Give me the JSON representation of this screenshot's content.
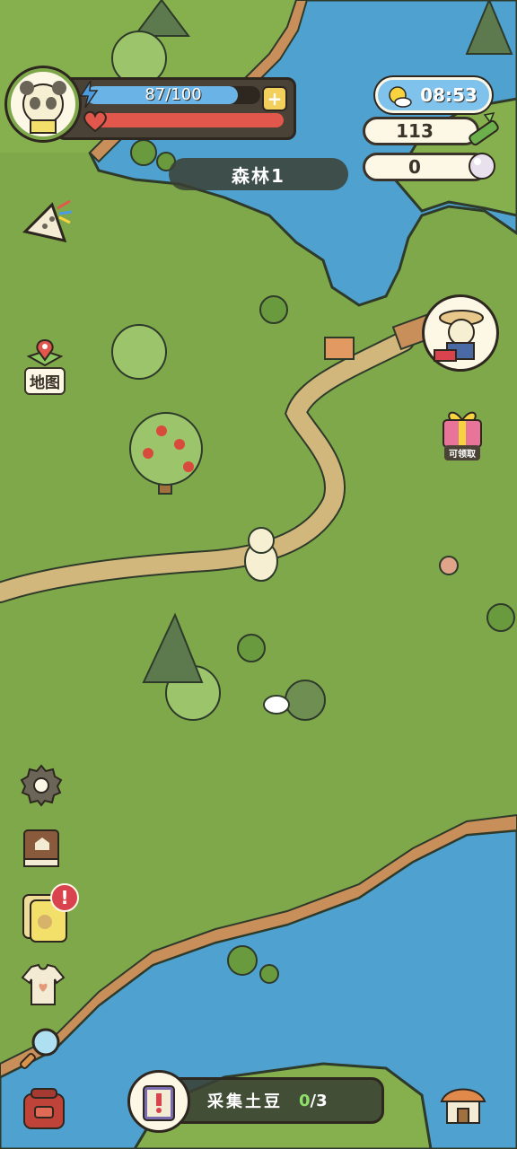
{
  "player": {
    "energy_text": "87/100",
    "energy_fraction": 0.87,
    "health_fraction": 1.0,
    "add_energy_glyph": "+"
  },
  "status": {
    "time": "08:53",
    "bamboo_count": "113",
    "pearl_count": "0"
  },
  "location": {
    "name": "森林1"
  },
  "left_menu": {
    "map_label": "地图",
    "alert_glyph": "!"
  },
  "right_menu": {
    "gift_label": "可领取"
  },
  "quest": {
    "title": "采集土豆",
    "progress_current": "0",
    "progress_total": "/3"
  },
  "icons": {
    "energy": "lightning-icon",
    "health": "heart-icon",
    "weather": "sun-cloud-icon",
    "bamboo": "bamboo-icon",
    "pearl": "pearl-icon",
    "kite": "kite-icon",
    "map": "map-pin-icon",
    "settings": "gear-icon",
    "recipe": "book-icon",
    "tag": "tag-icon",
    "clothes": "shirt-icon",
    "search": "magnifier-icon",
    "backpack": "backpack-icon",
    "house": "house-icon"
  },
  "colors": {
    "grass": "#7fa84a",
    "water": "#4fa2d0",
    "path": "#d2b77c",
    "energy_bar": "#6ab3e6",
    "health_bar": "#e2574c"
  }
}
